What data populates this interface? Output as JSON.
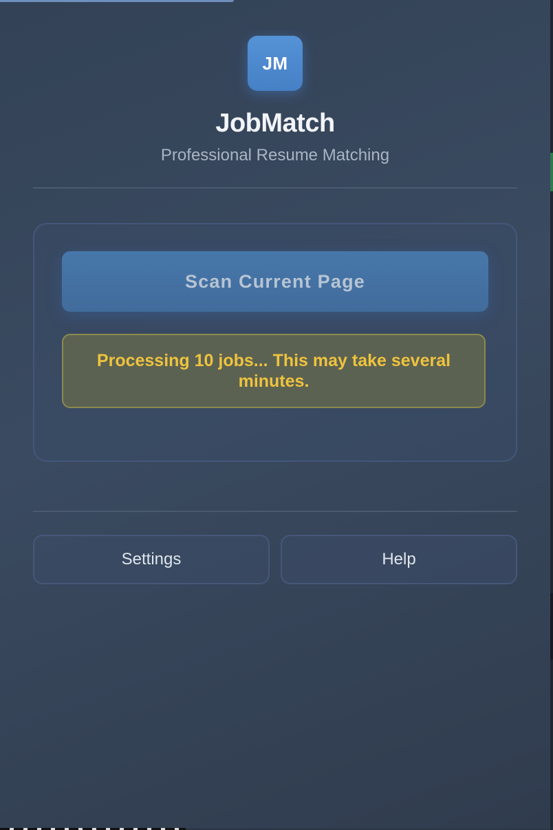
{
  "app": {
    "logo_text": "JM",
    "title": "JobMatch",
    "subtitle": "Professional Resume Matching"
  },
  "actions": {
    "scan_label": "Scan Current Page"
  },
  "status": {
    "message": "Processing 10 jobs... This may take several minutes.",
    "color": "#eec33e"
  },
  "footer": {
    "settings_label": "Settings",
    "help_label": "Help"
  },
  "colors": {
    "accent": "#4a85cc",
    "background": "#354459"
  }
}
